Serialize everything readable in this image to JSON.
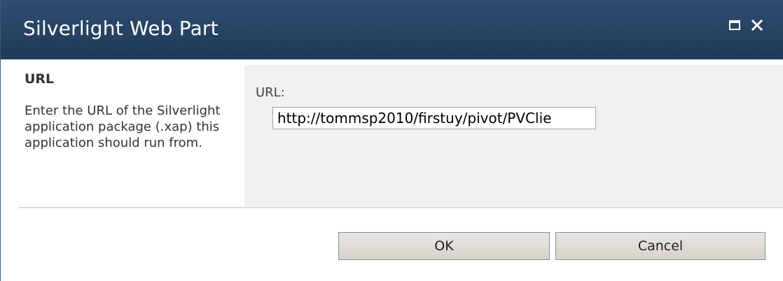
{
  "dialog": {
    "title": "Silverlight Web Part"
  },
  "section": {
    "heading": "URL",
    "description": "Enter the URL of the Silverlight application package (.xap) this application should run from.",
    "field_label": "URL:",
    "url_value": "http://tommsp2010/firstuy/pivot/PVClie"
  },
  "buttons": {
    "ok_label": "OK",
    "cancel_label": "Cancel"
  },
  "icons": {
    "maximize": "maximize-icon",
    "close": "close-icon"
  },
  "colors": {
    "titlebar": "#2a4868",
    "panel_gray": "#f1f1f1",
    "button_face": "#e0ddd7"
  }
}
